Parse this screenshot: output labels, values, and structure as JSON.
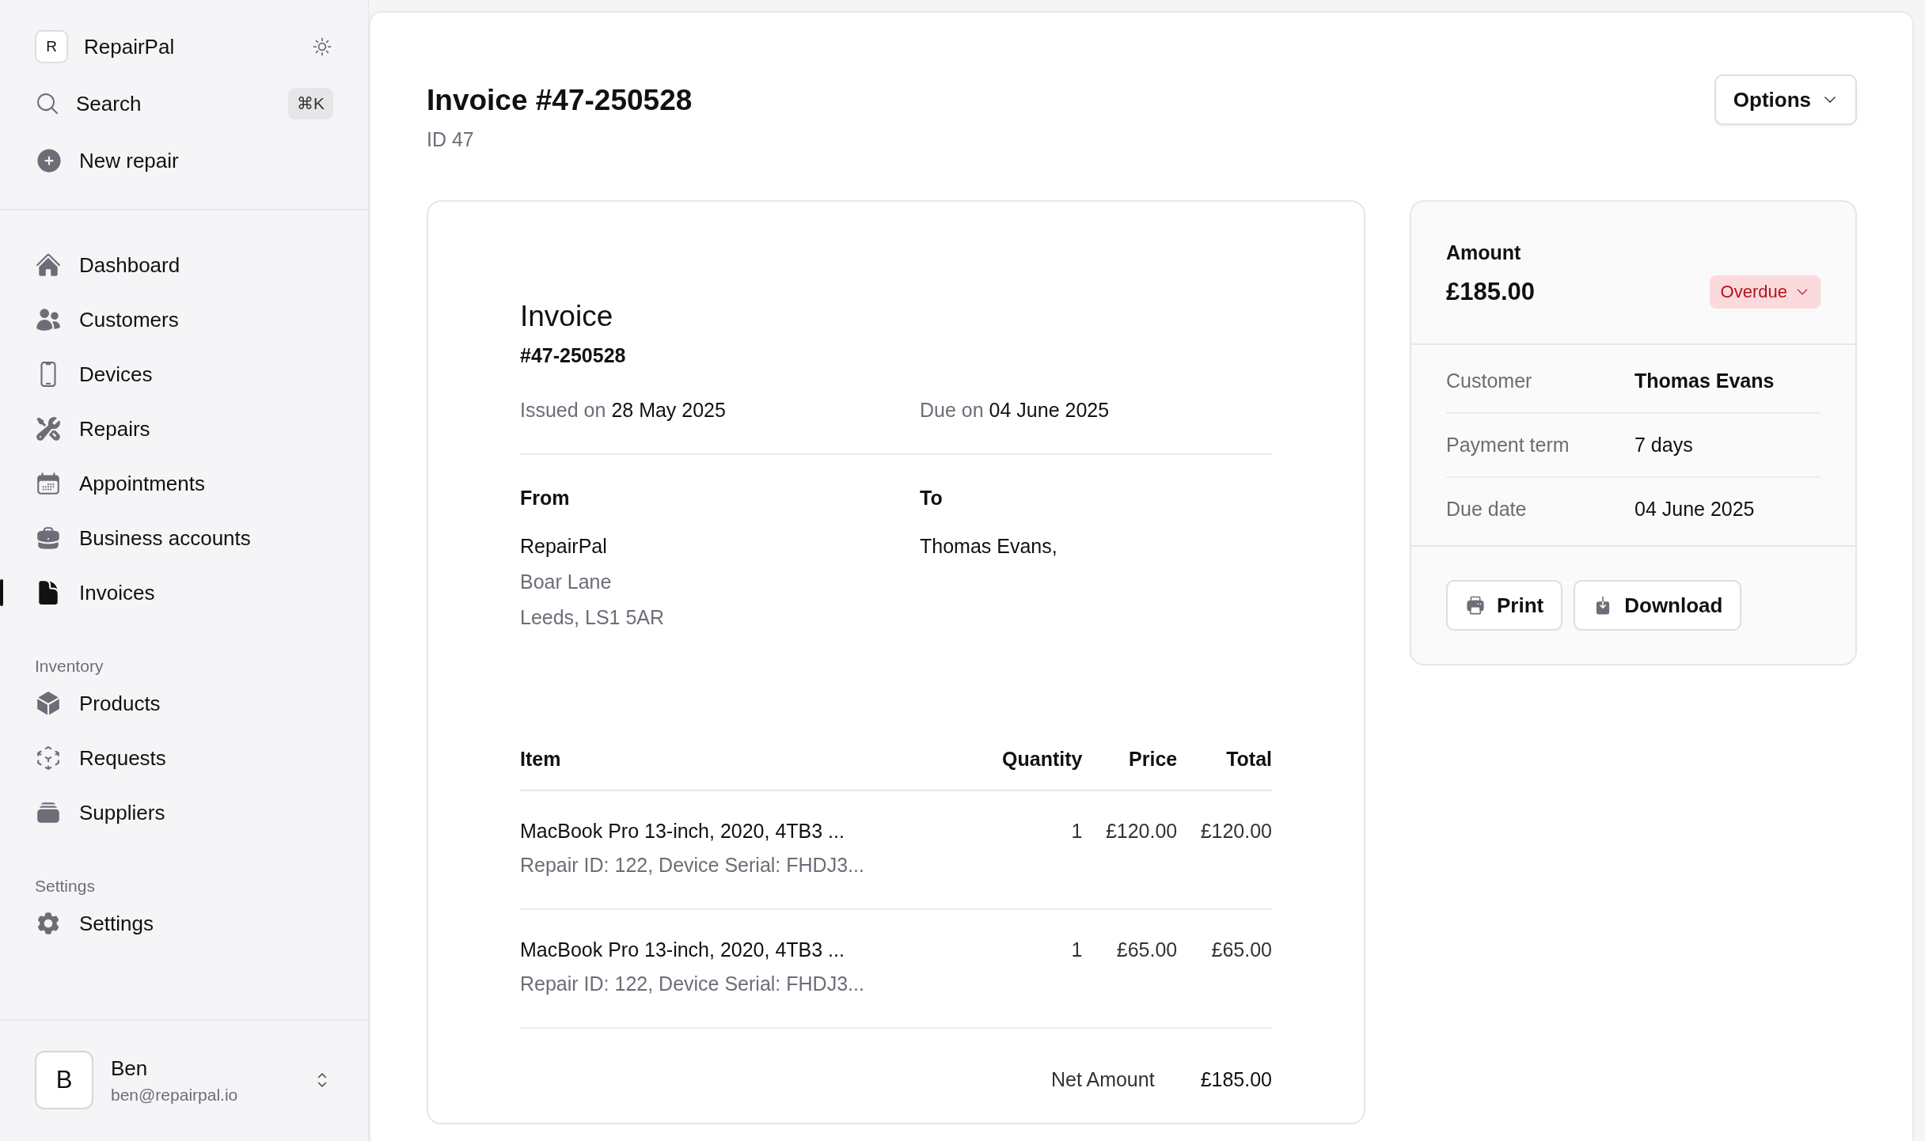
{
  "brand": {
    "initial": "R",
    "name": "RepairPal"
  },
  "search": {
    "label": "Search",
    "shortcut": "⌘K"
  },
  "new_repair": {
    "label": "New repair"
  },
  "nav": [
    {
      "label": "Dashboard",
      "selected": false
    },
    {
      "label": "Customers",
      "selected": false
    },
    {
      "label": "Devices",
      "selected": false
    },
    {
      "label": "Repairs",
      "selected": false
    },
    {
      "label": "Appointments",
      "selected": false
    },
    {
      "label": "Business accounts",
      "selected": false
    },
    {
      "label": "Invoices",
      "selected": true
    }
  ],
  "inventory": {
    "heading": "Inventory",
    "items": [
      {
        "label": "Products",
        "selected": false
      },
      {
        "label": "Requests",
        "selected": false
      },
      {
        "label": "Suppliers",
        "selected": false
      }
    ]
  },
  "settings": {
    "heading": "Settings",
    "items": [
      {
        "label": "Settings",
        "selected": false
      }
    ]
  },
  "user": {
    "initial": "B",
    "name": "Ben",
    "email": "ben@repairpal.io"
  },
  "page": {
    "title": "Invoice #47-250528",
    "subtitle": "ID 47",
    "options_button": "Options"
  },
  "invoice": {
    "title": "Invoice",
    "number": "#47-250528",
    "issued": {
      "label": "Issued on",
      "value": "28 May 2025"
    },
    "due": {
      "label": "Due on",
      "value": "04 June 2025"
    },
    "from": {
      "heading": "From",
      "lines": [
        "RepairPal",
        "Boar Lane",
        "Leeds, LS1 5AR"
      ]
    },
    "to": {
      "heading": "To",
      "lines": [
        "Thomas Evans,"
      ]
    },
    "table": {
      "columns": [
        "Item",
        "Quantity",
        "Price",
        "Total"
      ],
      "rows": [
        {
          "item": "MacBook Pro 13-inch, 2020, 4TB3 ...",
          "detail": "Repair ID: 122, Device Serial: FHDJ3...",
          "quantity": "1",
          "price": "£120.00",
          "total": "£120.00"
        },
        {
          "item": "MacBook Pro 13-inch, 2020, 4TB3 ...",
          "detail": "Repair ID: 122, Device Serial: FHDJ3...",
          "quantity": "1",
          "price": "£65.00",
          "total": "£65.00"
        }
      ]
    },
    "net": {
      "label": "Net Amount",
      "value": "£185.00"
    }
  },
  "summary": {
    "label": "Amount",
    "amount": "£185.00",
    "status": "Overdue",
    "details": [
      {
        "label": "Customer",
        "value": "Thomas Evans",
        "emphasis": true
      },
      {
        "label": "Payment term",
        "value": "7 days",
        "emphasis": false
      },
      {
        "label": "Due date",
        "value": "04 June 2025",
        "emphasis": false
      }
    ],
    "buttons": [
      "Print",
      "Download"
    ]
  }
}
